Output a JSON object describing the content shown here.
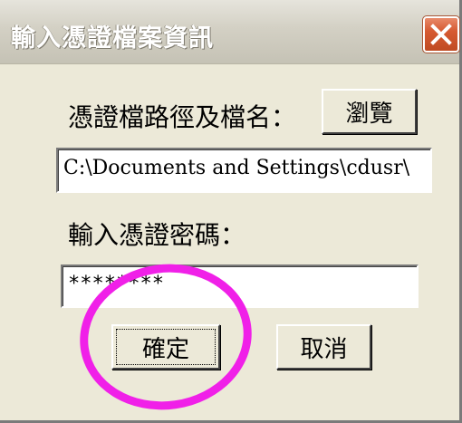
{
  "window": {
    "title": "輸入憑證檔案資訊",
    "close_icon": "close-icon"
  },
  "form": {
    "path_label": "憑證檔路徑及檔名：",
    "browse_label": "瀏覽",
    "path_value": "C:\\Documents and Settings\\cdusr\\",
    "password_label": "輸入憑證密碼：",
    "password_value": "********"
  },
  "buttons": {
    "ok_label": "確定",
    "cancel_label": "取消"
  },
  "colors": {
    "face": "#ECE9D8",
    "close": "#D65A32",
    "highlight_circle": "#F020E8"
  }
}
